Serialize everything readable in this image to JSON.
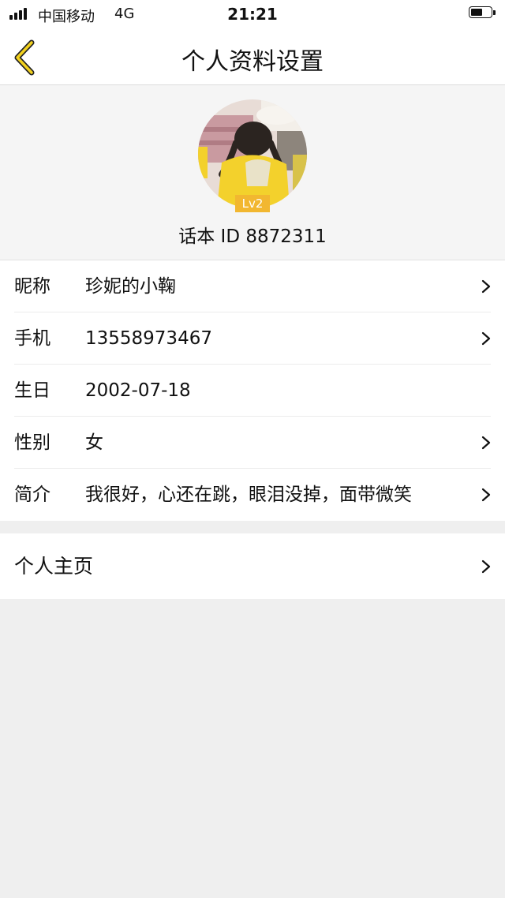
{
  "status_bar": {
    "carrier": "中国移动",
    "network": "4G",
    "time": "21:21",
    "battery_level": 0.6
  },
  "nav": {
    "title": "个人资料设置",
    "back_icon": "chevron-left-icon",
    "accent_color": "#f2d11e"
  },
  "profile": {
    "level_badge": "Lv2",
    "id_label": "话本 ID",
    "id_value": "8872311",
    "badge_color": "#f2b730"
  },
  "info_rows": [
    {
      "label": "昵称",
      "value": "珍妮的小鞠",
      "has_arrow": true
    },
    {
      "label": "手机",
      "value": "13558973467",
      "has_arrow": true
    },
    {
      "label": "生日",
      "value": "2002-07-18",
      "has_arrow": false
    },
    {
      "label": "性别",
      "value": "女",
      "has_arrow": true
    },
    {
      "label": "简介",
      "value": "我很好，心还在跳，眼泪没掉，面带微笑",
      "has_arrow": true
    }
  ],
  "homepage": {
    "label": "个人主页"
  }
}
